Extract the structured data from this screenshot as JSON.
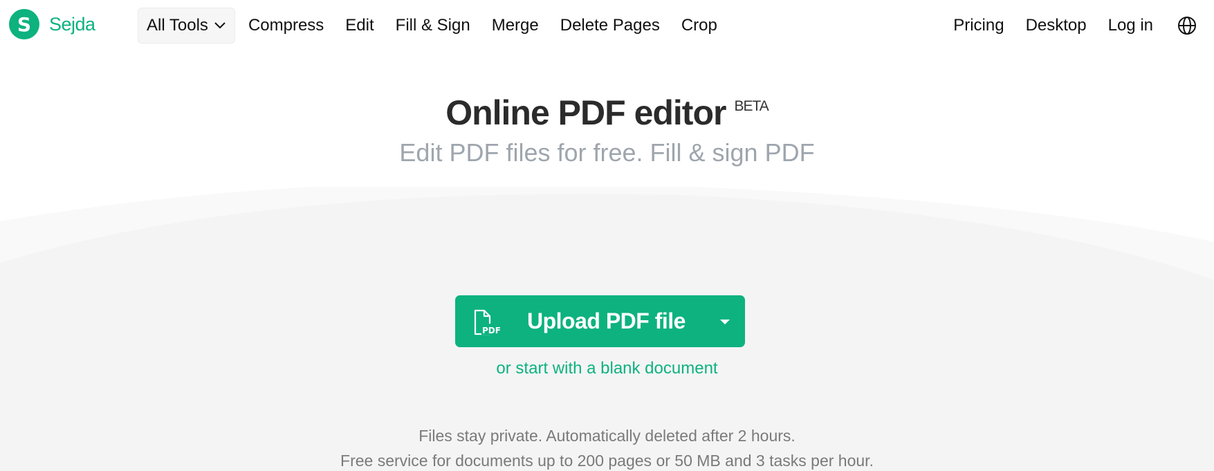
{
  "brand": {
    "logo_letter": "S",
    "name": "Sejda",
    "color": "#0db27f"
  },
  "nav": {
    "all_tools_label": "All Tools",
    "links": [
      "Compress",
      "Edit",
      "Fill & Sign",
      "Merge",
      "Delete Pages",
      "Crop"
    ],
    "right_links": [
      "Pricing",
      "Desktop",
      "Log in"
    ],
    "language_icon": "globe-icon"
  },
  "hero": {
    "title": "Online PDF editor",
    "badge": "BETA",
    "subtitle": "Edit PDF files for free. Fill & sign PDF"
  },
  "upload": {
    "label": "Upload PDF file",
    "icon": "pdf-file-icon",
    "caret_icon": "caret-down-icon",
    "blank_link": "or start with a blank document"
  },
  "info": {
    "line1": "Files stay private. Automatically deleted after 2 hours.",
    "line2": "Free service for documents up to 200 pages or 50 MB and 3 tasks per hour."
  },
  "colors": {
    "accent": "#0db27f",
    "band": "#f4f4f4",
    "subtitle": "#9ea5ad"
  }
}
